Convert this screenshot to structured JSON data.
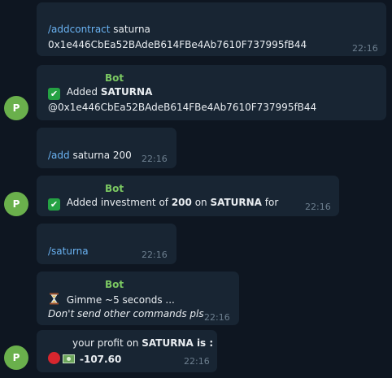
{
  "avatar_letter": "P",
  "bot_name": "Bot",
  "messages": [
    {
      "command": "/addcontract",
      "arg": " saturna",
      "line2": "0x1e446CbEa52BAdeB614FBe4Ab7610F737995fB44",
      "time": "22:16"
    },
    {
      "prefix": " Added ",
      "bold": "SATURNA",
      "line2": "@0x1e446CbEa52BAdeB614FBe4Ab7610F737995fB44",
      "time": "22:16"
    },
    {
      "command": "/add",
      "arg": " saturna 200",
      "time": "22:16"
    },
    {
      "prefix": " Added investment of ",
      "amount": "200",
      "on": " on ",
      "token": "SATURNA",
      "suffix": " for",
      "time": "22:16"
    },
    {
      "command": "/saturna",
      "time": "22:16"
    },
    {
      "line1": " Gimme ~5 seconds ...",
      "line2": "Don't send other commands pls",
      "time": "22:16"
    },
    {
      "prefix": "your profit on ",
      "token": "SATURNA",
      "suffix": " is :",
      "value": "-107.60",
      "time": "22:16"
    }
  ],
  "icons": {
    "check": "check-mark-button-icon",
    "hourglass": "hourglass-icon",
    "red_circle": "red-circle-icon",
    "money": "dollar-banknote-icon"
  },
  "colors": {
    "background": "#0e1621",
    "bubble": "#182533",
    "command_link": "#6ab3f3",
    "bot_name": "#7bc862",
    "avatar": "#6ab04c",
    "timestamp": "#6d7f8f"
  }
}
